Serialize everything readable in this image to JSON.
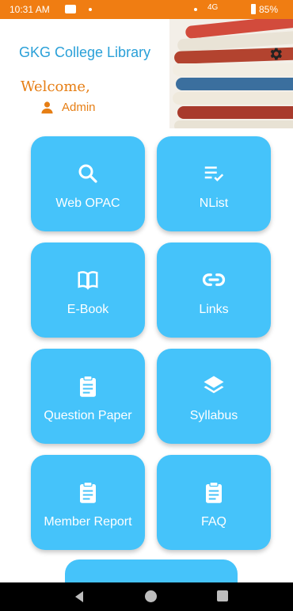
{
  "status_bar": {
    "time": "10:31 AM",
    "network": "4G",
    "battery": "85%"
  },
  "header": {
    "title": "GKG College Library",
    "welcome": "Welcome,",
    "user": "Admin"
  },
  "tiles": [
    {
      "label": "Web OPAC",
      "icon": "search-icon"
    },
    {
      "label": "NList",
      "icon": "checklist-icon"
    },
    {
      "label": "E-Book",
      "icon": "book-icon"
    },
    {
      "label": "Links",
      "icon": "link-icon"
    },
    {
      "label": "Question Paper",
      "icon": "clipboard-icon"
    },
    {
      "label": "Syllabus",
      "icon": "layers-icon"
    },
    {
      "label": "Member Report",
      "icon": "clipboard-icon"
    },
    {
      "label": "FAQ",
      "icon": "clipboard-icon"
    }
  ],
  "colors": {
    "status_bar": "#f07d12",
    "title": "#2aa0d8",
    "accent": "#e67e14",
    "tile": "#45c3fa"
  }
}
